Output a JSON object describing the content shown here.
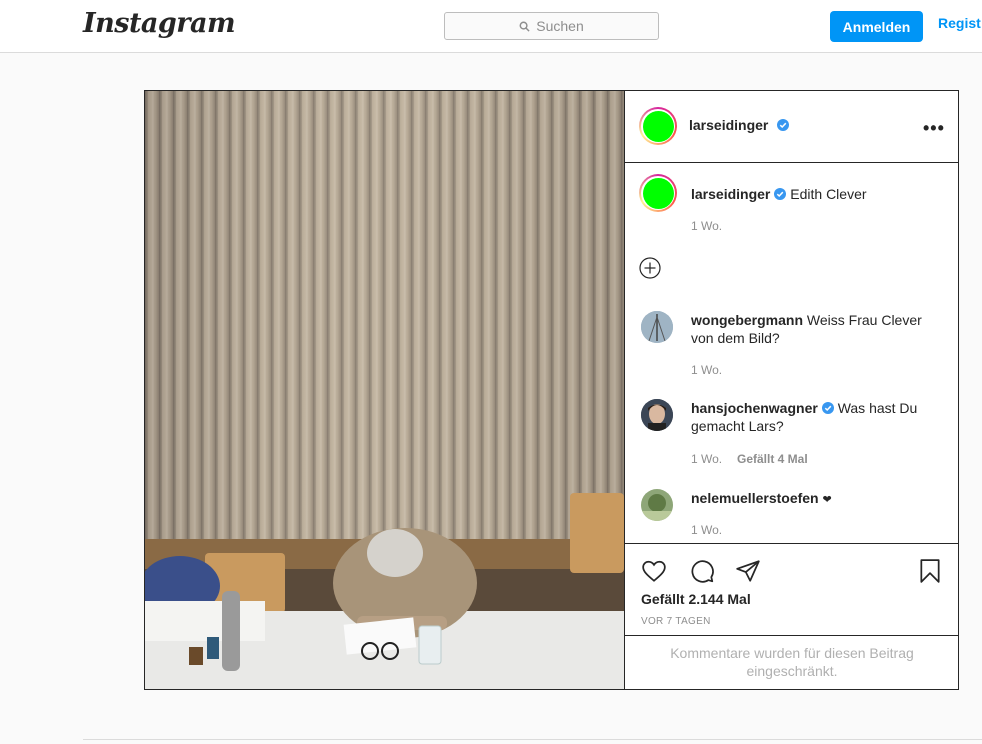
{
  "header": {
    "logo": "Instagram",
    "search_placeholder": "Suchen",
    "login_label": "Anmelden",
    "register_label": "Regist"
  },
  "post": {
    "author": "larseidinger",
    "caption": {
      "author": "larseidinger",
      "text": "Edith Clever",
      "time": "1 Wo."
    },
    "comments": [
      {
        "author": "wongebergmann",
        "text": "Weiss Frau Clever",
        "text2": "von dem Bild?",
        "time": "1 Wo."
      },
      {
        "author": "hansjochenwagner",
        "text": "Was hast Du",
        "text2": "gemacht Lars?",
        "time": "1 Wo.",
        "likes": "Gefällt 4 Mal"
      },
      {
        "author": "nelemuellerstoefen",
        "text": "❤",
        "time": "1 Wo."
      }
    ],
    "likes": "Gefällt 2.144 Mal",
    "posted": "VOR 7 TAGEN",
    "restricted_notice": "Kommentare wurden für diesen Beitrag eingeschränkt."
  },
  "colors": {
    "accent": "#0095f6",
    "avatar_placeholder": "#00ff00",
    "verified": "#3897f0"
  }
}
